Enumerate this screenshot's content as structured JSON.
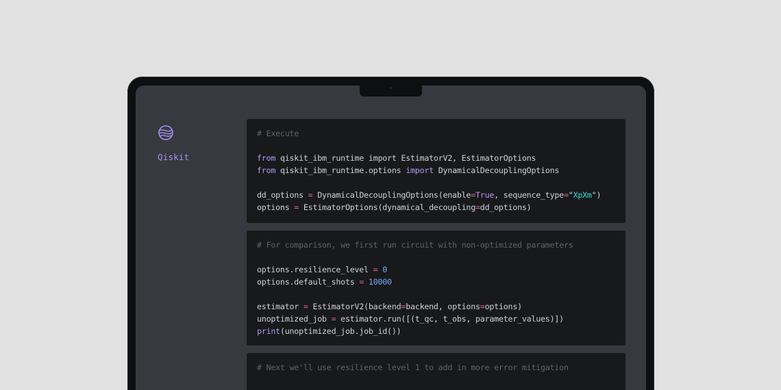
{
  "colors": {
    "background": "#e1e1e1",
    "bezel": "#0e0f10",
    "screen": "#363a3f",
    "code_bg": "#17191b",
    "brand": "#a88dee",
    "keyword": "#b497f0",
    "operator": "#e06b8d",
    "number": "#78a9ff",
    "string": "#3ddbd9",
    "comment": "#5e646b"
  },
  "sidebar": {
    "logo_icon": "qiskit-logo-icon",
    "brand_label": "Qiskit"
  },
  "cells": [
    {
      "lines": [
        {
          "tokens": [
            {
              "t": "# Execute",
              "c": "cm"
            }
          ]
        },
        {
          "tokens": []
        },
        {
          "tokens": [
            {
              "t": "from",
              "c": "kw"
            },
            {
              "t": " qiskit_ibm_runtime import EstimatorV2, EstimatorOptions",
              "c": ""
            }
          ]
        },
        {
          "tokens": [
            {
              "t": "from",
              "c": "kw"
            },
            {
              "t": " qiskit_ibm_runtime.options ",
              "c": ""
            },
            {
              "t": "import",
              "c": "kw"
            },
            {
              "t": " DynamicalDecouplingOptions",
              "c": ""
            }
          ]
        },
        {
          "tokens": []
        },
        {
          "tokens": [
            {
              "t": "dd_options ",
              "c": ""
            },
            {
              "t": "=",
              "c": "op"
            },
            {
              "t": " DynamicalDecouplingOptions(enable",
              "c": ""
            },
            {
              "t": "=",
              "c": "op"
            },
            {
              "t": "True",
              "c": "kw"
            },
            {
              "t": ", sequence_type",
              "c": ""
            },
            {
              "t": "=",
              "c": "op"
            },
            {
              "t": "\"",
              "c": ""
            },
            {
              "t": "XpXm",
              "c": "str"
            },
            {
              "t": "\")",
              "c": ""
            }
          ]
        },
        {
          "tokens": [
            {
              "t": "options ",
              "c": ""
            },
            {
              "t": "=",
              "c": "op"
            },
            {
              "t": " EstimatorOptions(dynamical_decoupling",
              "c": ""
            },
            {
              "t": "=",
              "c": "op"
            },
            {
              "t": "dd_options)",
              "c": ""
            }
          ]
        }
      ]
    },
    {
      "lines": [
        {
          "tokens": [
            {
              "t": "# For comparison, we first run circuit with non-optimized parameters",
              "c": "cm"
            }
          ]
        },
        {
          "tokens": []
        },
        {
          "tokens": [
            {
              "t": "options.resilience_level ",
              "c": ""
            },
            {
              "t": "=",
              "c": "op"
            },
            {
              "t": " ",
              "c": ""
            },
            {
              "t": "0",
              "c": "num"
            }
          ]
        },
        {
          "tokens": [
            {
              "t": "options.default_shots ",
              "c": ""
            },
            {
              "t": "=",
              "c": "op"
            },
            {
              "t": " ",
              "c": ""
            },
            {
              "t": "10000",
              "c": "num"
            }
          ]
        },
        {
          "tokens": []
        },
        {
          "tokens": [
            {
              "t": "estimator ",
              "c": ""
            },
            {
              "t": "=",
              "c": "op"
            },
            {
              "t": " EstimatorV2(backend",
              "c": ""
            },
            {
              "t": "=",
              "c": "op"
            },
            {
              "t": "backend, options",
              "c": ""
            },
            {
              "t": "=",
              "c": "op"
            },
            {
              "t": "options)",
              "c": ""
            }
          ]
        },
        {
          "tokens": [
            {
              "t": "unoptimized_job ",
              "c": ""
            },
            {
              "t": "=",
              "c": "op"
            },
            {
              "t": " estimator.run([(t_qc, t_obs, parameter_values)])",
              "c": ""
            }
          ]
        },
        {
          "tokens": [
            {
              "t": "print",
              "c": "kw"
            },
            {
              "t": "(unoptimized_job.job_id())",
              "c": ""
            }
          ]
        }
      ]
    },
    {
      "lines": [
        {
          "tokens": [
            {
              "t": "# Next we'll use resilience level 1 to add in more error mitigation",
              "c": "cm"
            }
          ]
        }
      ]
    }
  ]
}
